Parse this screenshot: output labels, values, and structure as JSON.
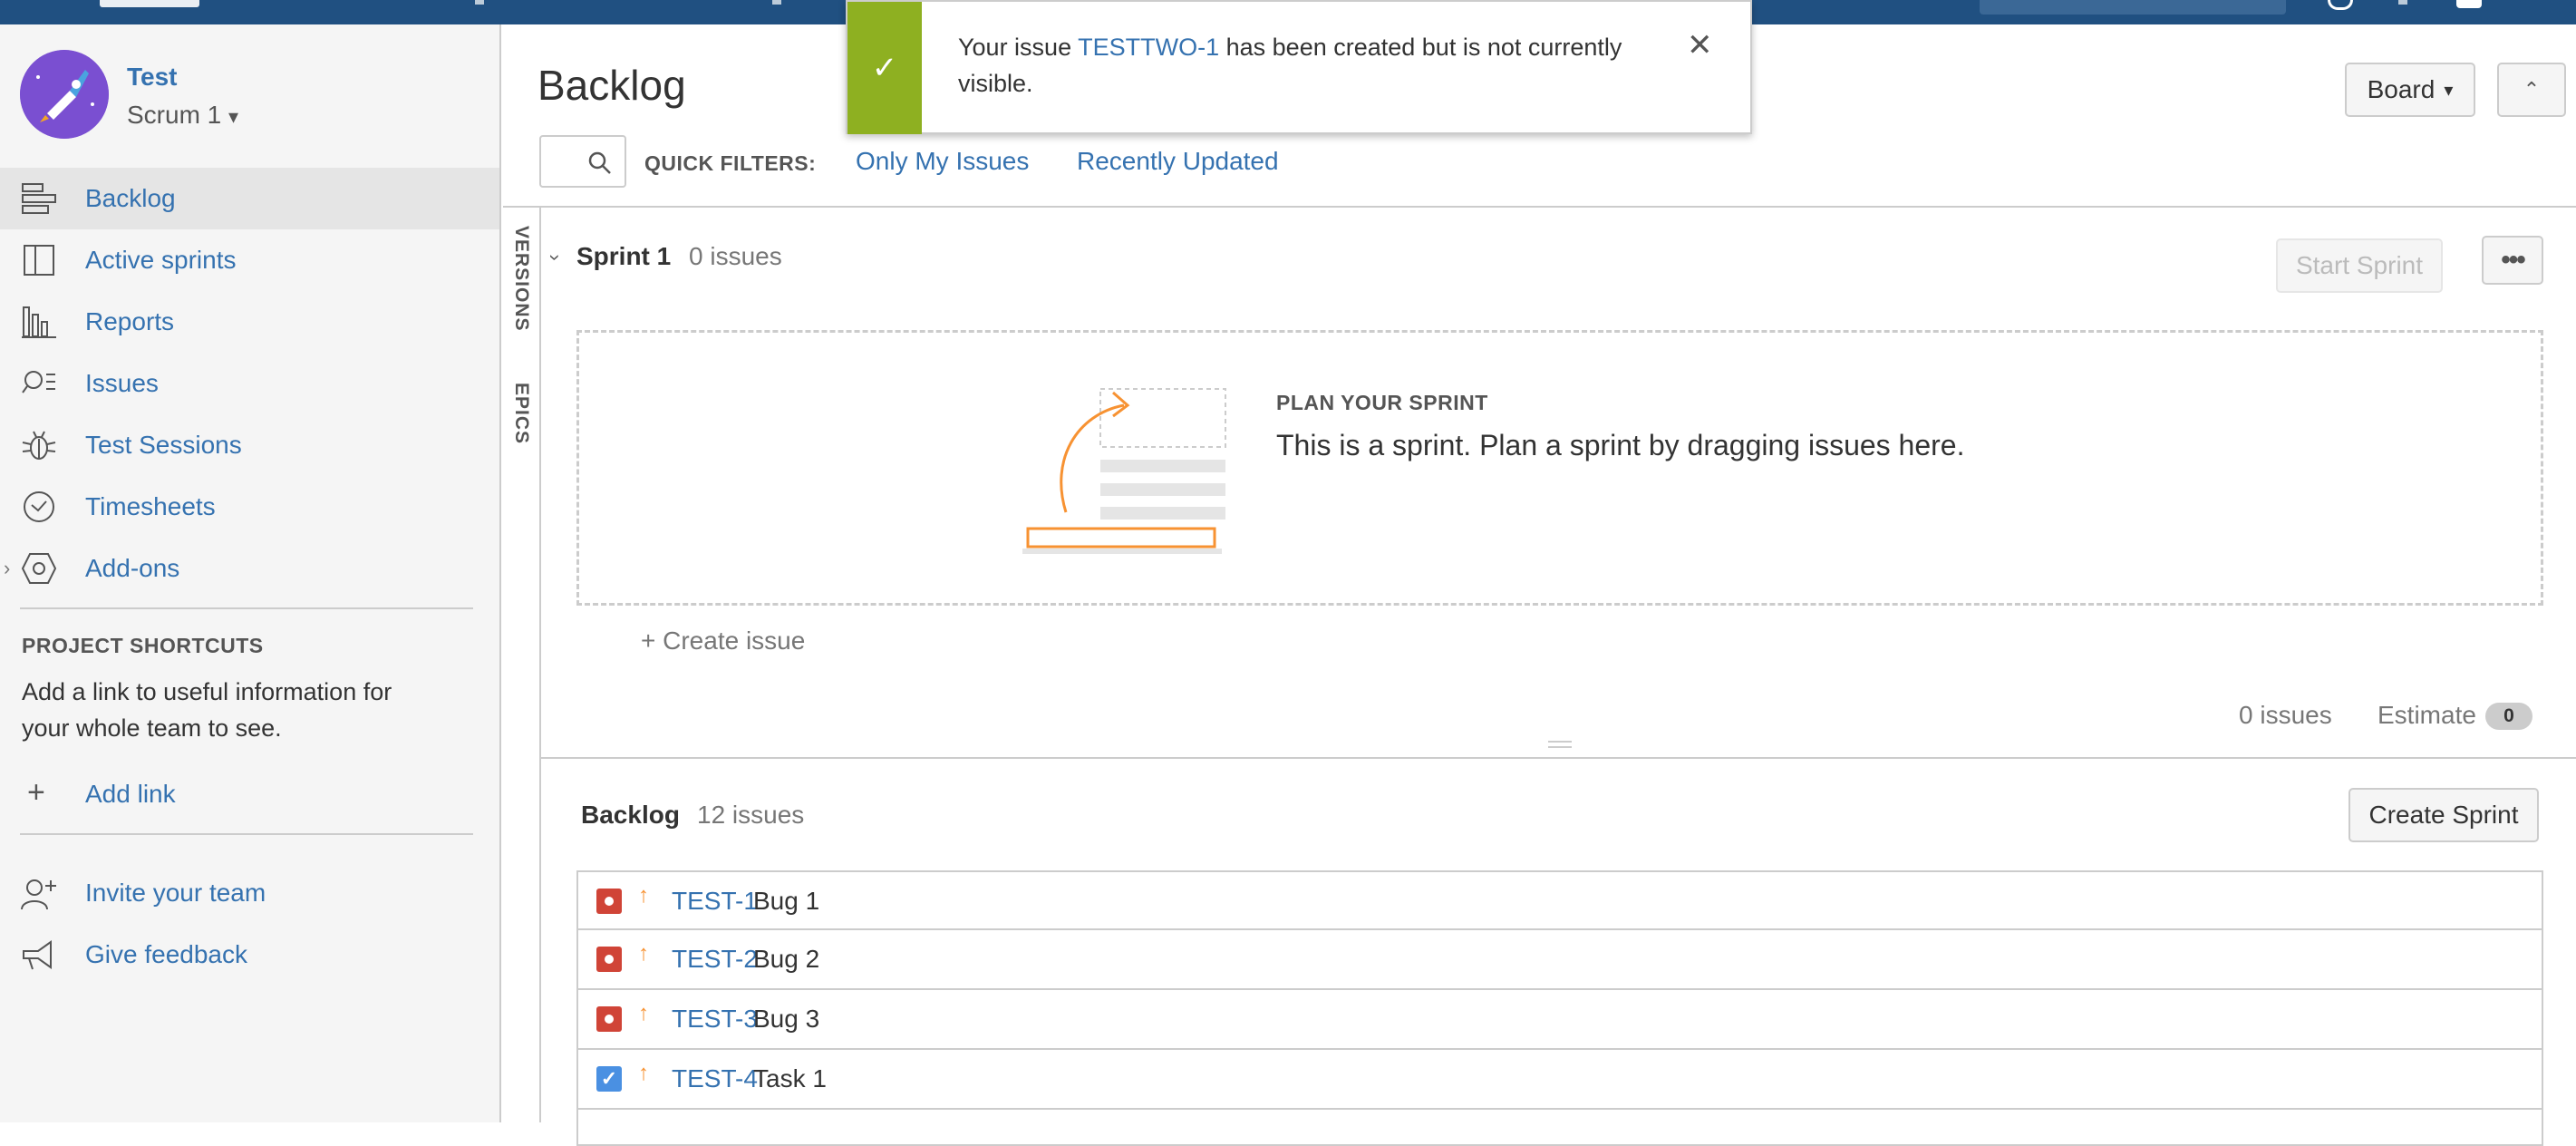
{
  "notification": {
    "prefix": "Your issue",
    "issue_key": "TESTTWO-1",
    "suffix": "has been created but is not currently visible.",
    "close_symbol": "✕"
  },
  "sidebar": {
    "project_name": "Test",
    "board_name": "Scrum 1",
    "board_caret": "▾",
    "nav": [
      {
        "label": "Backlog",
        "icon": "backlog-icon",
        "active": true
      },
      {
        "label": "Active sprints",
        "icon": "active-sprints-icon"
      },
      {
        "label": "Reports",
        "icon": "reports-icon"
      },
      {
        "label": "Issues",
        "icon": "issues-icon"
      },
      {
        "label": "Test Sessions",
        "icon": "bug-icon"
      },
      {
        "label": "Timesheets",
        "icon": "clock-icon"
      },
      {
        "label": "Add-ons",
        "icon": "addons-icon",
        "expandable": true
      }
    ],
    "expand_symbol": "›",
    "shortcuts_heading": "PROJECT SHORTCUTS",
    "shortcuts_text": "Add a link to useful information for your whole team to see.",
    "add_link": "Add link",
    "add_symbol": "+",
    "invite": "Invite your team",
    "feedback": "Give feedback"
  },
  "header": {
    "title": "Backlog",
    "quick_filters_label": "QUICK FILTERS:",
    "quick_filters": [
      "Only My Issues",
      "Recently Updated"
    ],
    "board_button": "Board",
    "board_caret": "▾",
    "collapse_symbol": "⌃"
  },
  "side_tabs": [
    "VERSIONS",
    "EPICS"
  ],
  "sprint": {
    "chevron": "›",
    "name": "Sprint 1",
    "issue_count": "0 issues",
    "start_button": "Start Sprint",
    "more_symbol": "•••",
    "plan_heading": "PLAN YOUR SPRINT",
    "plan_text": "This is a sprint. Plan a sprint by dragging issues here.",
    "create_issue": "+ Create issue",
    "footer_count": "0 issues",
    "estimate_label": "Estimate",
    "estimate_value": "0"
  },
  "backlog": {
    "name": "Backlog",
    "issue_count": "12 issues",
    "create_sprint": "Create Sprint",
    "priority_symbol": "↑",
    "task_check": "✓",
    "issues": [
      {
        "type": "bug",
        "key": "TEST-1",
        "summary": "Bug 1"
      },
      {
        "type": "bug",
        "key": "TEST-2",
        "summary": "Bug 2"
      },
      {
        "type": "bug",
        "key": "TEST-3",
        "summary": "Bug 3"
      },
      {
        "type": "task",
        "key": "TEST-4",
        "summary": "Task 1"
      }
    ]
  },
  "colors": {
    "topbar": "#205081",
    "link": "#3572b0",
    "success": "#8eb021",
    "bug": "#d04437",
    "task": "#4a90e2",
    "priority": "#f79232"
  }
}
